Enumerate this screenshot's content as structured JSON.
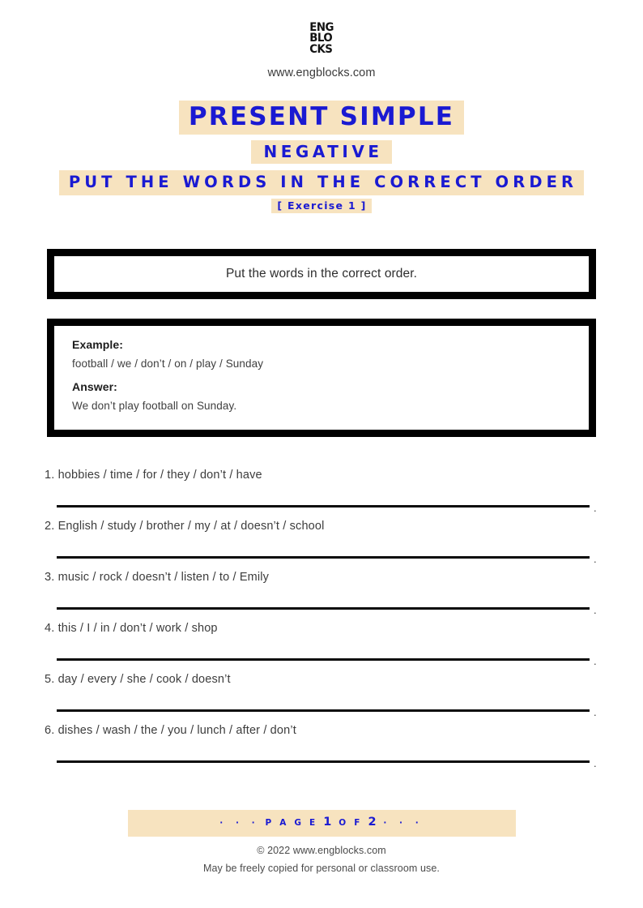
{
  "header": {
    "logo": {
      "name": "engblocks-logo",
      "lines": [
        "ENG",
        "BLO",
        "CKS"
      ]
    },
    "site_url": "www.engblocks.com"
  },
  "titles": {
    "main": "PRESENT SIMPLE",
    "sub": "NEGATIVE",
    "task": "PUT THE WORDS IN THE CORRECT ORDER",
    "exercise": "[ Exercise 1 ]"
  },
  "instruction": {
    "text": "Put the words in the correct order."
  },
  "example": {
    "example_label": "Example:",
    "example_text": "football / we / don’t / on / play / Sunday",
    "answer_label": "Answer:",
    "answer_text": "We don’t play football on Sunday."
  },
  "questions": [
    {
      "number": "1.",
      "text": "hobbies / time / for / they / don’t / have",
      "trailing": "."
    },
    {
      "number": "2.",
      "text": "English / study / brother / my / at / doesn’t / school",
      "trailing": "."
    },
    {
      "number": "3.",
      "text": "music / rock / doesn’t / listen / to / Emily",
      "trailing": "."
    },
    {
      "number": "4.",
      "text": "this / I / in / don’t / work / shop",
      "trailing": "."
    },
    {
      "number": "5.",
      "text": "day / every / she / cook / doesn’t",
      "trailing": "."
    },
    {
      "number": "6.",
      "text": "dishes / wash / the / you / lunch / after / don’t",
      "trailing": "."
    }
  ],
  "footer": {
    "page_bar": {
      "dots_left": "·  ·  ·",
      "page_word": "P A G E",
      "current_page": "1",
      "of_word": "O F",
      "total_pages": "2",
      "dots_right": "·  ·  ·"
    },
    "copyright": "© 2022 www.engblocks.com",
    "license": "May be freely copied for personal or classroom use."
  },
  "colors": {
    "accent_blue": "#1a1ad2",
    "highlight_tan": "#f7e3bf",
    "border_black": "#000000",
    "body_text": "#3c3c3c"
  }
}
